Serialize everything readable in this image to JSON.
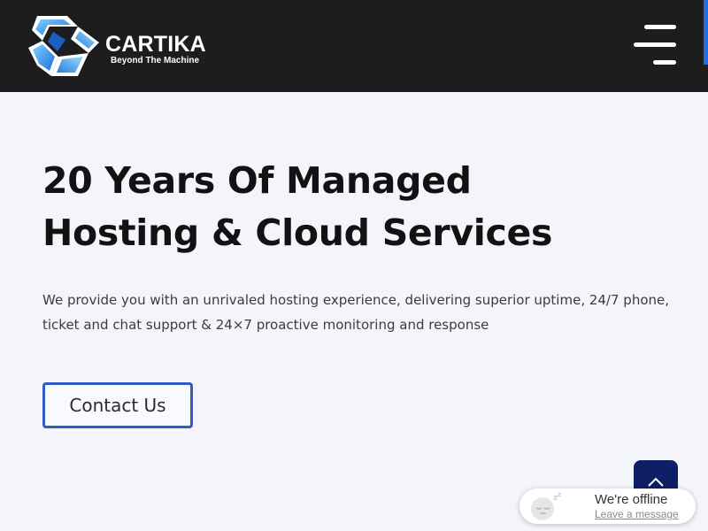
{
  "header": {
    "brand_name": "CARTIKA",
    "tagline": "Beyond The Machine",
    "menu_icon": "hamburger-menu-icon",
    "background": "#1d1d1f",
    "accent": "#1f6fe0"
  },
  "hero": {
    "title_line1": "20 Years Of Managed",
    "title_line2": "Hosting & Cloud Services",
    "desc_line1": "We provide you with an unrivaled hosting experience, delivering superior uptime, 24/7 phone,",
    "desc_line2": "ticket and chat support & 24×7 proactive monitoring and response",
    "cta_label": "Contact Us",
    "cta_border": "#2f5cc4"
  },
  "back_to_top": {
    "icon": "chevron-up-icon",
    "color": "#0f1f66"
  },
  "chat": {
    "status": "We're offline",
    "link": "Leave a message",
    "avatar_icon": "sleeping-face-icon"
  }
}
